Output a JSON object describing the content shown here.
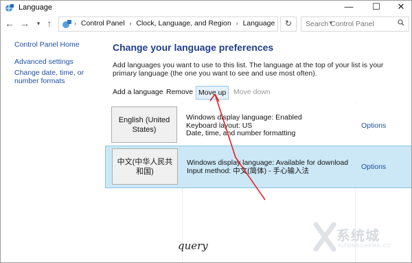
{
  "window": {
    "title": "Language",
    "icon": "language-globe-icon",
    "controls": [
      "minimize-icon",
      "maximize-icon",
      "close-icon"
    ]
  },
  "address": {
    "breadcrumbs": [
      "Control Panel",
      "Clock, Language, and Region",
      "Language"
    ],
    "search_placeholder": "Search Control Panel"
  },
  "sidebar": {
    "items": [
      {
        "label": "Control Panel Home"
      },
      {
        "label": "Advanced settings"
      },
      {
        "label": "Change date, time, or number formats"
      }
    ]
  },
  "main": {
    "heading": "Change your language preferences",
    "description": "Add languages you want to use to this list. The language at the top of your list is your primary language (the one you want to see and use most often)."
  },
  "toolbar": {
    "add": "Add a language",
    "remove": "Remove",
    "move_up": "Move up",
    "move_down": "Move down"
  },
  "languages": [
    {
      "name": "English (United States)",
      "details": [
        "Windows display language: Enabled",
        "Keyboard layout: US",
        "Date, time, and number formatting"
      ],
      "options": "Options",
      "selected": false
    },
    {
      "name": "中文(中华人民共和国)",
      "details": [
        "Windows display language: Available for download",
        "Input method: 中文(简体) - 手心输入法"
      ],
      "options": "Options",
      "selected": true
    }
  ],
  "annotation": {
    "signature": "query",
    "arrow_color": "#e02020"
  },
  "watermark": {
    "text": "系统城",
    "subtext": "XITONGCHENG.CC"
  },
  "colors": {
    "link": "#1e4fa3",
    "heading": "#1e3f8c",
    "selected_row": "#cce8f7",
    "move_up_highlight": "#e5f1fb"
  }
}
